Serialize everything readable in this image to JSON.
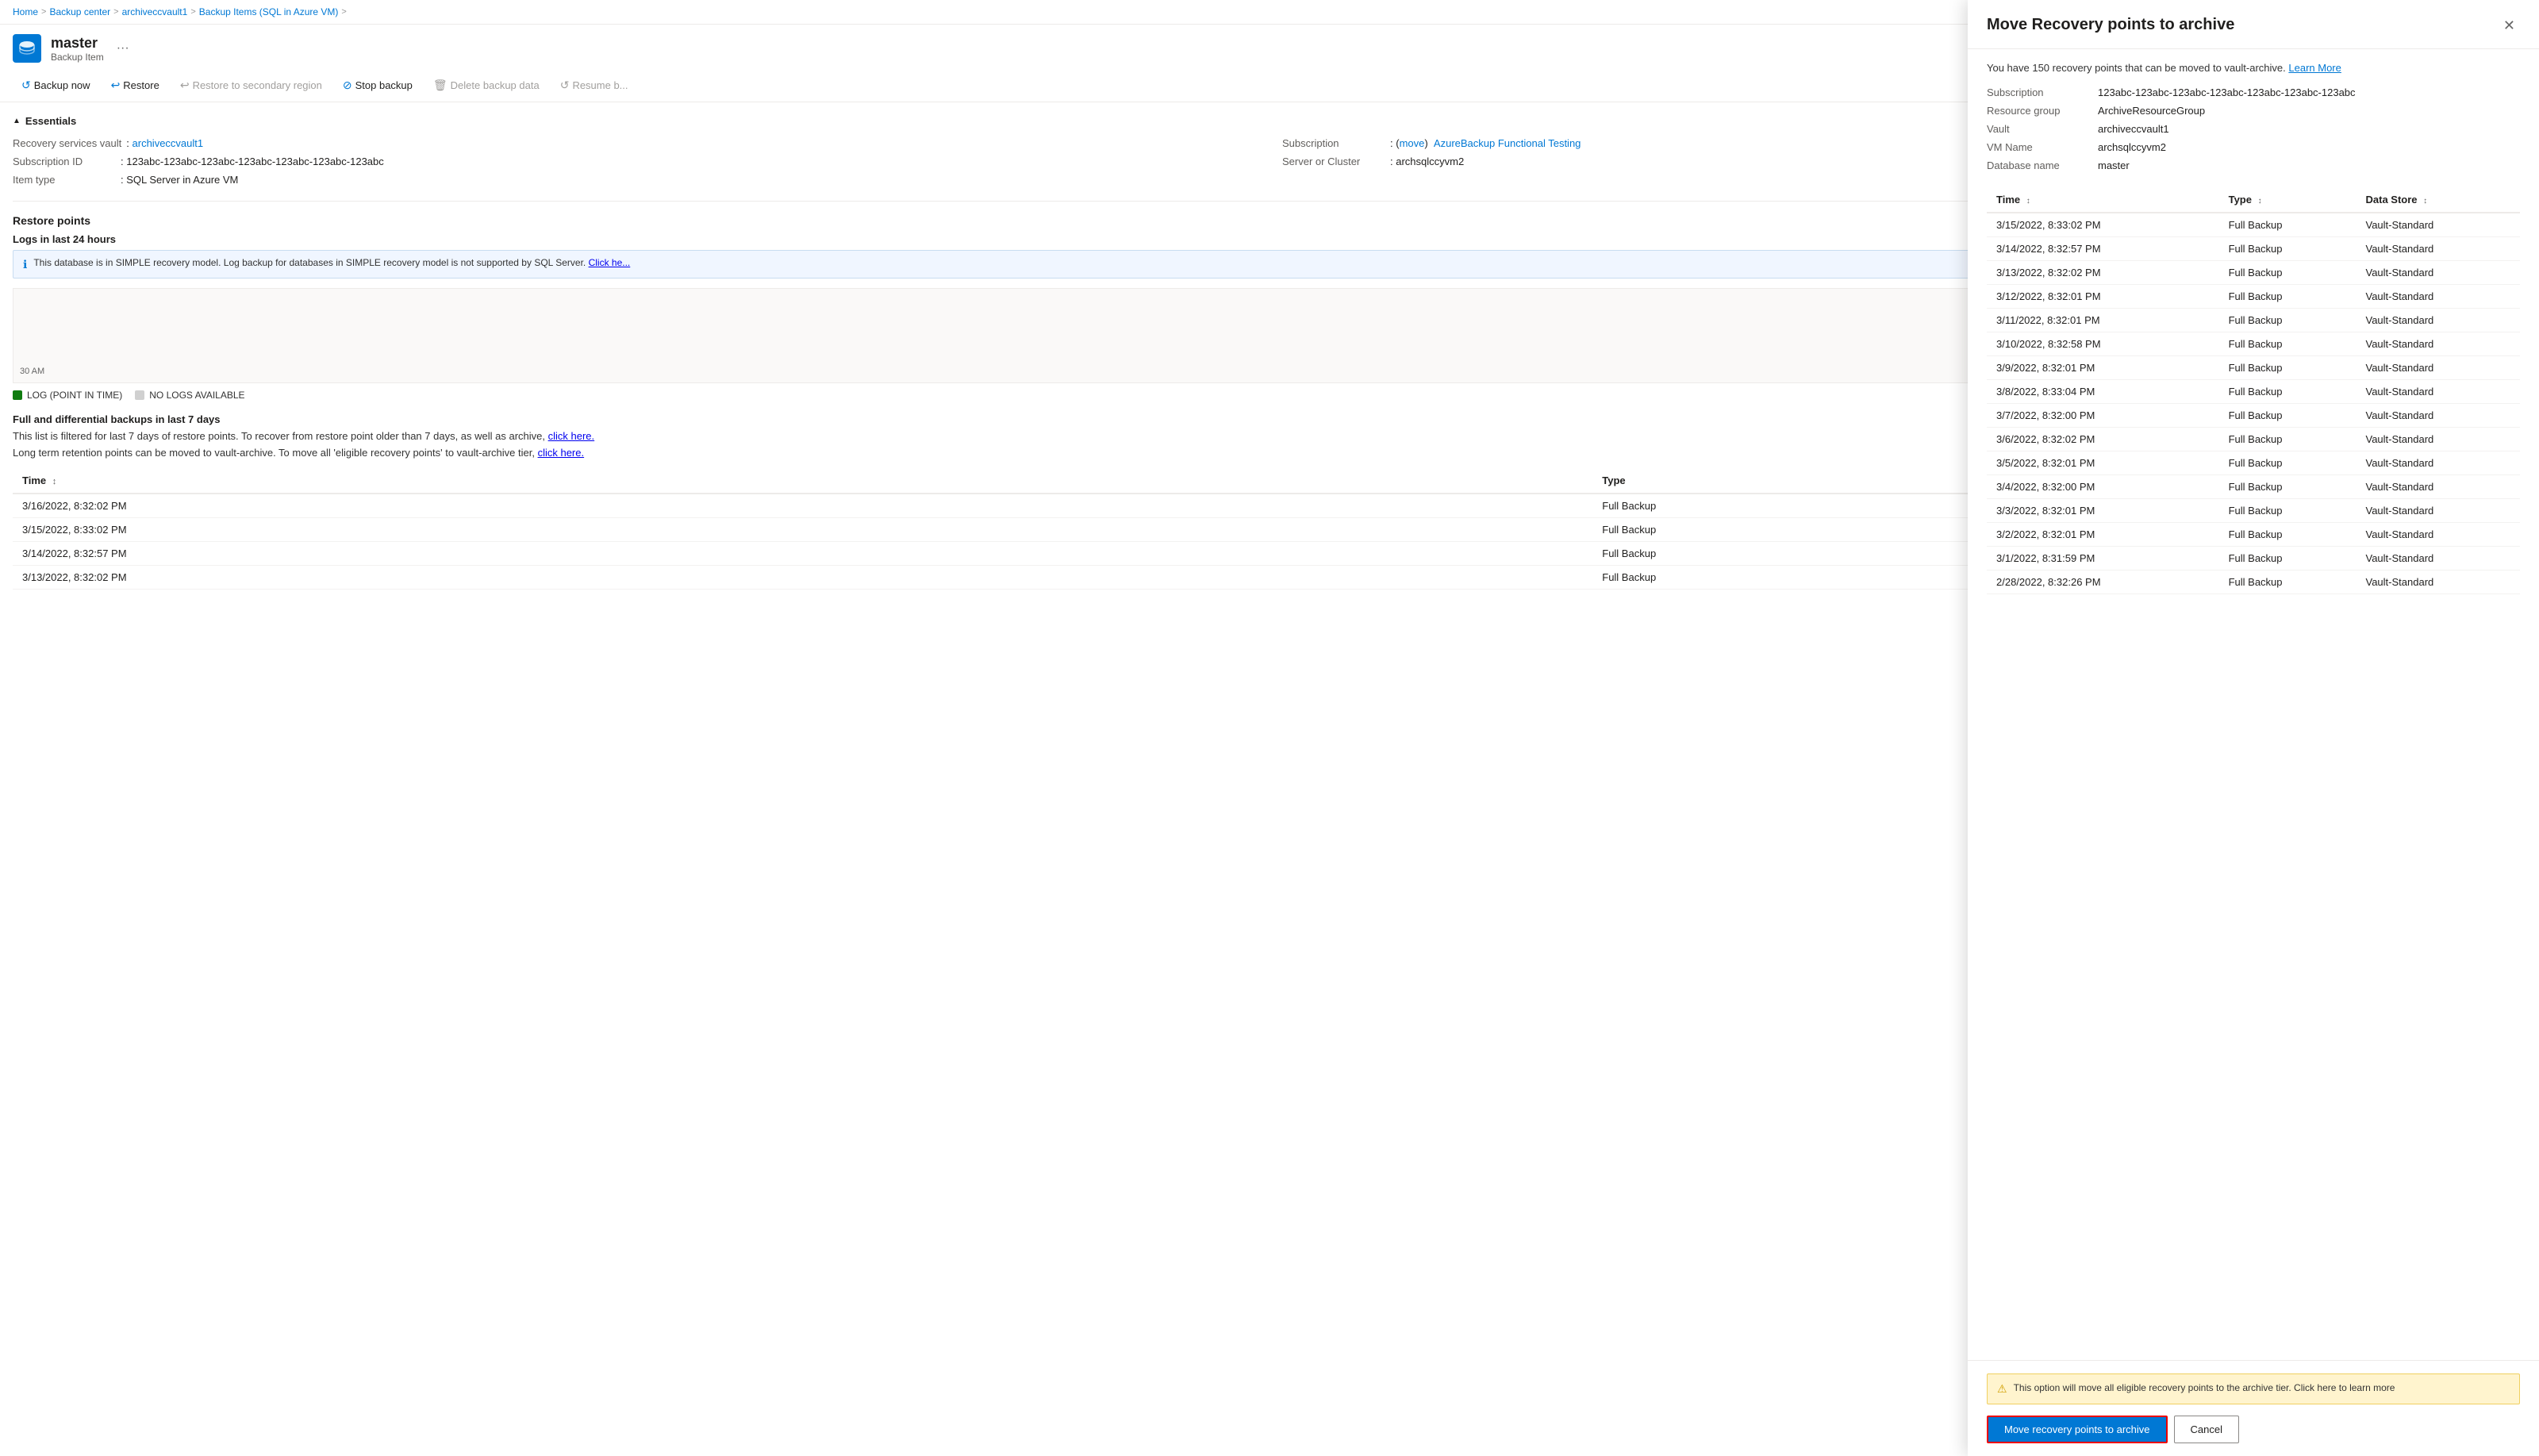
{
  "breadcrumb": {
    "items": [
      "Home",
      "Backup center",
      "archiveccvault1",
      "Backup Items (SQL in Azure VM)"
    ],
    "separator": ">"
  },
  "header": {
    "title": "master",
    "subtitle": "Backup Item",
    "icon": "🗄"
  },
  "toolbar": {
    "buttons": [
      {
        "id": "backup-now",
        "label": "Backup now",
        "icon": "↺",
        "disabled": false
      },
      {
        "id": "restore",
        "label": "Restore",
        "icon": "↩",
        "disabled": false
      },
      {
        "id": "restore-secondary",
        "label": "Restore to secondary region",
        "icon": "↩",
        "disabled": true
      },
      {
        "id": "stop-backup",
        "label": "Stop backup",
        "icon": "⊘",
        "disabled": false
      },
      {
        "id": "delete-backup",
        "label": "Delete backup data",
        "icon": "🗑",
        "disabled": true
      },
      {
        "id": "resume-backup",
        "label": "Resume b...",
        "icon": "↺",
        "disabled": true
      }
    ]
  },
  "essentials": {
    "title": "Essentials",
    "fields": [
      {
        "label": "Recovery services vault",
        "value": "archiveccvault1",
        "link": true
      },
      {
        "label": "Subscription",
        "value": "AzureBackup Functional Testing",
        "link": true,
        "prefix": "(move)",
        "prefix_link": true
      },
      {
        "label": "Subscription ID",
        "value": "123abc-123abc-123abc-123abc-123abc-123abc-123abc"
      },
      {
        "label": "Server or Cluster",
        "value": "archsqlccyvm2"
      },
      {
        "label": "Item type",
        "value": "SQL Server in Azure VM"
      }
    ]
  },
  "restore_points": {
    "title": "Restore points"
  },
  "logs_section": {
    "title": "Logs in last 24 hours",
    "info_text": "This database is in SIMPLE recovery model. Log backup for databases in SIMPLE recovery model is not supported by SQL Server.",
    "info_link": "Click he...",
    "chart_label": "30 AM",
    "legend": [
      {
        "label": "LOG (POINT IN TIME)",
        "color": "#107c10"
      },
      {
        "label": "NO LOGS AVAILABLE",
        "color": "#d0d0d0"
      }
    ]
  },
  "full_backups": {
    "title": "Full and differential backups in last 7 days",
    "desc1": "This list is filtered for last 7 days of restore points. To recover from restore point older than 7 days, as well as archive,",
    "link1": "click here.",
    "desc2": "Long term retention points can be moved to vault-archive. To move all 'eligible recovery points' to vault-archive tier,",
    "link2": "click here.",
    "columns": [
      "Time",
      "Type"
    ],
    "rows": [
      {
        "time": "3/16/2022, 8:32:02 PM",
        "type": "Full Backup"
      },
      {
        "time": "3/15/2022, 8:33:02 PM",
        "type": "Full Backup"
      },
      {
        "time": "3/14/2022, 8:32:57 PM",
        "type": "Full Backup"
      },
      {
        "time": "3/13/2022, 8:32:02 PM",
        "type": "Full Backup"
      }
    ]
  },
  "panel": {
    "title": "Move Recovery points to archive",
    "desc": "You have 150 recovery points that can be moved to vault-archive.",
    "learn_more": "Learn More",
    "info": {
      "subscription": "123abc-123abc-123abc-123abc-123abc-123abc-123abc",
      "resource_group": "ArchiveResourceGroup",
      "vault": "archiveccvault1",
      "vm_name": "archsqlccyvm2",
      "database_name": "master"
    },
    "table": {
      "columns": [
        "Time",
        "Type",
        "Data Store"
      ],
      "rows": [
        {
          "time": "3/15/2022, 8:33:02 PM",
          "type": "Full Backup",
          "datastore": "Vault-Standard"
        },
        {
          "time": "3/14/2022, 8:32:57 PM",
          "type": "Full Backup",
          "datastore": "Vault-Standard"
        },
        {
          "time": "3/13/2022, 8:32:02 PM",
          "type": "Full Backup",
          "datastore": "Vault-Standard"
        },
        {
          "time": "3/12/2022, 8:32:01 PM",
          "type": "Full Backup",
          "datastore": "Vault-Standard"
        },
        {
          "time": "3/11/2022, 8:32:01 PM",
          "type": "Full Backup",
          "datastore": "Vault-Standard"
        },
        {
          "time": "3/10/2022, 8:32:58 PM",
          "type": "Full Backup",
          "datastore": "Vault-Standard"
        },
        {
          "time": "3/9/2022, 8:32:01 PM",
          "type": "Full Backup",
          "datastore": "Vault-Standard"
        },
        {
          "time": "3/8/2022, 8:33:04 PM",
          "type": "Full Backup",
          "datastore": "Vault-Standard"
        },
        {
          "time": "3/7/2022, 8:32:00 PM",
          "type": "Full Backup",
          "datastore": "Vault-Standard"
        },
        {
          "time": "3/6/2022, 8:32:02 PM",
          "type": "Full Backup",
          "datastore": "Vault-Standard"
        },
        {
          "time": "3/5/2022, 8:32:01 PM",
          "type": "Full Backup",
          "datastore": "Vault-Standard"
        },
        {
          "time": "3/4/2022, 8:32:00 PM",
          "type": "Full Backup",
          "datastore": "Vault-Standard"
        },
        {
          "time": "3/3/2022, 8:32:01 PM",
          "type": "Full Backup",
          "datastore": "Vault-Standard"
        },
        {
          "time": "3/2/2022, 8:32:01 PM",
          "type": "Full Backup",
          "datastore": "Vault-Standard"
        },
        {
          "time": "3/1/2022, 8:31:59 PM",
          "type": "Full Backup",
          "datastore": "Vault-Standard"
        },
        {
          "time": "2/28/2022, 8:32:26 PM",
          "type": "Full Backup",
          "datastore": "Vault-Standard"
        }
      ]
    },
    "warning_text": "This option will move all eligible recovery points to the archive tier. Click here to learn more",
    "btn_primary": "Move recovery points to archive",
    "btn_cancel": "Cancel"
  }
}
